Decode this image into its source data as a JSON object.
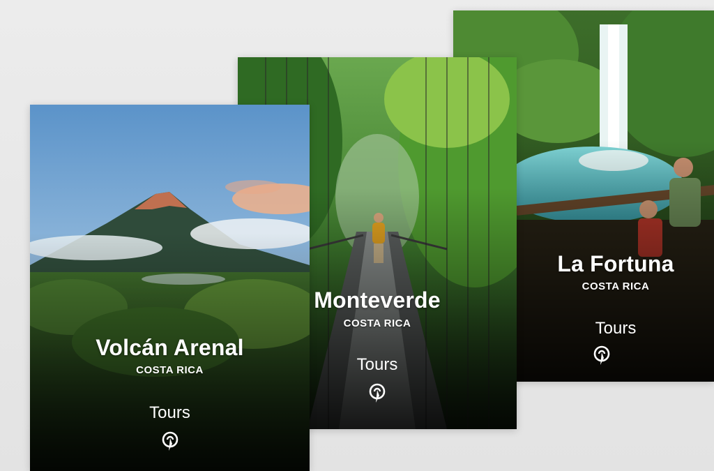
{
  "cards": [
    {
      "title": "Volcán Arenal",
      "subtitle": "COSTA RICA",
      "cta": "Tours",
      "icon": "tour-guide-icon"
    },
    {
      "title": "Monteverde",
      "subtitle": "COSTA RICA",
      "cta": "Tours",
      "icon": "tour-guide-icon"
    },
    {
      "title": "La Fortuna",
      "subtitle": "COSTA RICA",
      "cta": "Tours",
      "icon": "tour-guide-icon"
    }
  ],
  "colors": {
    "text": "#ffffff",
    "background": "#e8e8e8",
    "sky": "#6fa3d6",
    "jungle": "#2f5a20",
    "water": "#5fc3c8"
  }
}
